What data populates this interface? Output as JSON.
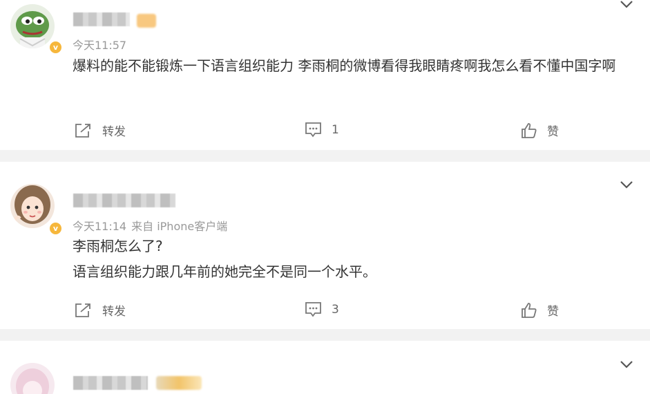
{
  "posts": [
    {
      "time": "今天11:57",
      "source": "",
      "content": [
        "爆料的能不能锻炼一下语言组织能力 李雨桐的微博看得我眼睛疼啊我怎么看不懂中国字啊"
      ],
      "repost_label": "转发",
      "comment_count": "1",
      "like_label": "赞",
      "verified_icon": "verified-v-icon"
    },
    {
      "time": "今天11:14",
      "source": "来自 iPhone客户端",
      "content": [
        "李雨桐怎么了?",
        "语言组织能力跟几年前的她完全不是同一个水平。"
      ],
      "repost_label": "转发",
      "comment_count": "3",
      "like_label": "赞",
      "verified_icon": "verified-v-icon"
    }
  ],
  "colors": {
    "meta": "#999999",
    "text": "#333333",
    "separator": "#f2f2f2",
    "badge": "#f6b73c"
  }
}
